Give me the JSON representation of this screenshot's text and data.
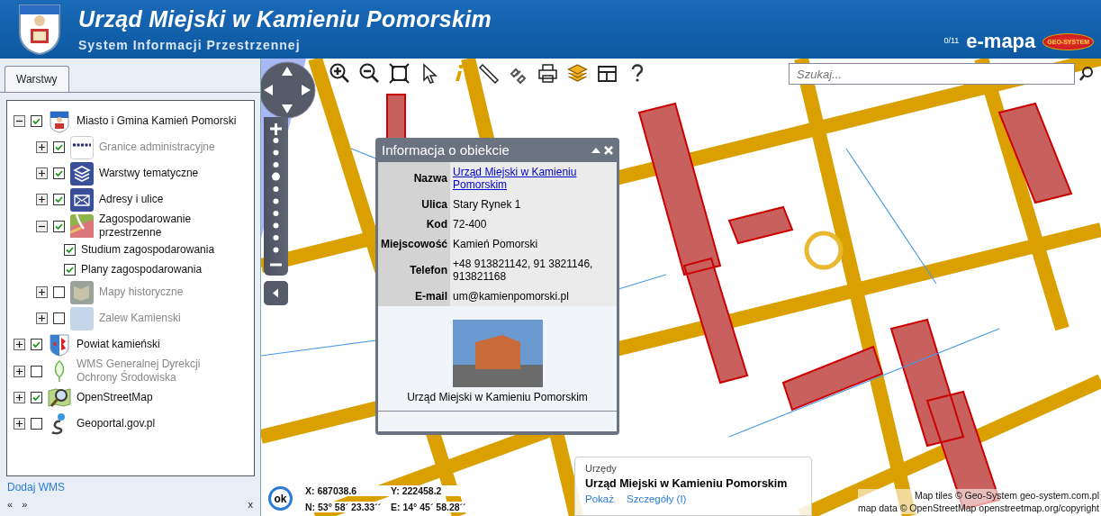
{
  "header": {
    "title": "Urząd Miejski w Kamieniu Pomorskim",
    "subtitle": "System Informacji Przestrzennej",
    "counter": "0/11",
    "brand": "e-mapa",
    "brand_badge": "GEO-SYSTEM"
  },
  "sidebar": {
    "tabs": [
      {
        "label": "Warstwy",
        "selected": true
      }
    ],
    "layers": [
      {
        "kind": "group",
        "label": "Miasto i Gmina Kamień Pomorski",
        "checked": true,
        "expanded": true,
        "dimmed": false,
        "children": [
          {
            "kind": "group",
            "label": "Granice administracyjne",
            "checked": true,
            "expanded": false,
            "dimmed": true
          },
          {
            "kind": "group",
            "label": "Warstwy tematyczne",
            "checked": true,
            "expanded": false,
            "dimmed": false
          },
          {
            "kind": "group",
            "label": "Adresy i ulice",
            "checked": true,
            "expanded": false,
            "dimmed": false
          },
          {
            "kind": "group",
            "label": "Zagospodarowanie przestrzenne",
            "checked": true,
            "expanded": true,
            "dimmed": false,
            "children": [
              {
                "kind": "sublayer",
                "label": "Studium zagospodarowania",
                "checked": true,
                "dimmed": false
              },
              {
                "kind": "sublayer",
                "label": "Plany zagospodarowania",
                "checked": true,
                "dimmed": false
              }
            ]
          },
          {
            "kind": "group",
            "label": "Mapy historyczne",
            "checked": false,
            "expanded": false,
            "dimmed": true
          },
          {
            "kind": "group",
            "label": "Zalew Kamienski",
            "checked": false,
            "expanded": false,
            "dimmed": true
          }
        ]
      },
      {
        "kind": "group",
        "label": "Powiat kamieński",
        "checked": true,
        "expanded": false,
        "dimmed": false
      },
      {
        "kind": "group",
        "label": "WMS Generalnej Dyrekcji Ochrony Środowiska",
        "checked": false,
        "expanded": false,
        "dimmed": true
      },
      {
        "kind": "group",
        "label": "OpenStreetMap",
        "checked": true,
        "expanded": false,
        "dimmed": false
      },
      {
        "kind": "group",
        "label": "Geoportal.gov.pl",
        "checked": false,
        "expanded": false,
        "dimmed": false
      }
    ],
    "add_link": "Dodaj WMS",
    "prev": "«",
    "next": "»",
    "close": "x"
  },
  "map": {
    "search": {
      "placeholder": "Szukaj..."
    },
    "zoom": {
      "level": 0.67
    },
    "popup": {
      "title": "Informacja o obiekcie",
      "rows": [
        {
          "kind": "link",
          "label": "Nazwa",
          "value": "Urząd Miejski w Kamieniu Pomorskim"
        },
        {
          "kind": "text",
          "label": "Ulica",
          "value": "Stary Rynek 1"
        },
        {
          "kind": "text",
          "label": "Kod",
          "value": "72-400"
        },
        {
          "kind": "text",
          "label": "Miejscowość",
          "value": "Kamień Pomorski"
        },
        {
          "kind": "text",
          "label": "Telefon",
          "value": "+48 913821142, 91 3821146, 913821168"
        },
        {
          "kind": "text",
          "label": "E-mail",
          "value": "um@kamienpomorski.pl"
        }
      ],
      "caption": "Urząd Miejski w Kamieniu Pomorskim"
    },
    "ok_button": "ok",
    "coords": {
      "x": "X: 687038.6",
      "y": "Y: 222458.2",
      "n": "N: 53° 58´ 23.33´´",
      "e": "E: 14° 45´ 58.28´´"
    },
    "tooltip": {
      "category": "Urzędy",
      "title": "Urząd Miejski w Kamieniu Pomorskim",
      "links": [
        "Pokaż",
        "Szczegóły (I)"
      ]
    },
    "attribution": [
      "Map tiles © Geo-System geo-system.com.pl",
      "map data © OpenStreetMap openstreetmap.org/copyright"
    ]
  }
}
